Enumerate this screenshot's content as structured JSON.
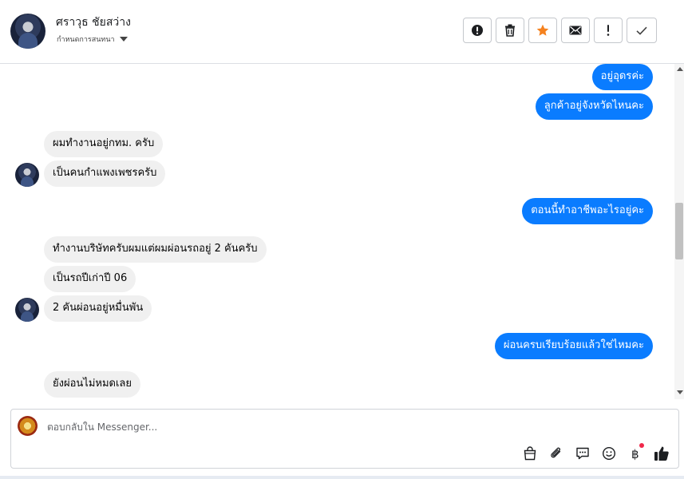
{
  "header": {
    "contact_name": "ศราวุธ ชัยสว่าง",
    "sub_label": "กำหนดการสนทนา"
  },
  "actions": [
    {
      "name": "report-button",
      "icon": "alert-circle-icon"
    },
    {
      "name": "delete-button",
      "icon": "trash-icon"
    },
    {
      "name": "star-button",
      "icon": "star-icon"
    },
    {
      "name": "mail-button",
      "icon": "envelope-icon"
    },
    {
      "name": "important-button",
      "icon": "exclamation-icon"
    },
    {
      "name": "done-button",
      "icon": "checkmark-icon"
    }
  ],
  "messages": [
    {
      "side": "out",
      "text": "อยู่อุดรค่ะ"
    },
    {
      "side": "out",
      "text": "ลูกค้าอยู่จังหวัดไหนคะ"
    },
    {
      "side": "in",
      "text": "ผมทำงานอยู่กทม. ครับ"
    },
    {
      "side": "in",
      "text": "เป็นคนกำแพงเพชรครับ"
    },
    {
      "side": "out",
      "text": "ตอนนี้ทำอาชีพอะไรอยู่คะ"
    },
    {
      "side": "in",
      "text": "ทำงานบริษัทครับผมแต่ผมผ่อนรถอยู่ 2 คันครับ"
    },
    {
      "side": "in",
      "text": "เป็นรถปีเก่าปี 06"
    },
    {
      "side": "in",
      "text": "2 คันผ่อนอยู่หมื่นพัน"
    },
    {
      "side": "out",
      "text": "ผ่อนครบเรียบร้อยแล้วใช่ไหมคะ"
    },
    {
      "side": "in",
      "text": "ยังผ่อนไม่หมดเลย"
    }
  ],
  "composer": {
    "placeholder": "ตอบกลับใน Messenger..."
  },
  "tools": [
    "bag-icon",
    "paperclip-icon",
    "chat-bubble-icon",
    "emoji-icon",
    "baht-icon",
    "thumbs-up-icon"
  ],
  "colors": {
    "outgoing_bubble": "#0a7cff",
    "incoming_bubble": "#f0f0f0",
    "star": "#f5821f",
    "notification_dot": "#f0284a"
  }
}
